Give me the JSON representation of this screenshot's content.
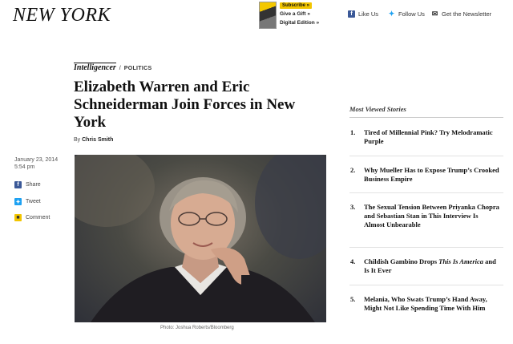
{
  "header": {
    "logo": "NEW YORK",
    "promo": {
      "subscribe": "Subscribe »",
      "gift": "Give a Gift »",
      "digital": "Digital Edition »"
    },
    "social": {
      "like": "Like Us",
      "follow": "Follow Us",
      "newsletter": "Get the Newsletter"
    }
  },
  "article": {
    "kicker_brand": "Intelligencer",
    "kicker_sep": "/",
    "section": "POLITICS",
    "headline": "Elizabeth Warren and Eric Schneiderman Join Forces in New York",
    "byline_prefix": "By",
    "author": "Chris Smith",
    "date": "January 23, 2014",
    "time": "5:54 pm",
    "share": {
      "facebook": "Share",
      "twitter": "Tweet",
      "comment": "Comment"
    },
    "photo_credit": "Photo: Joshua Roberts/Bloomberg"
  },
  "sidebar": {
    "title": "Most Viewed Stories",
    "stories": [
      {
        "num": "1.",
        "title": "Tired of Millennial Pink? Try Melodramatic Purple"
      },
      {
        "num": "2.",
        "title": "Why Mueller Has to Expose Trump’s Crooked Business Empire"
      },
      {
        "num": "3.",
        "title": "The Sexual Tension Between Priyanka Chopra and Sebastian Stan in This Interview Is Almost Unbearable"
      },
      {
        "num": "4.",
        "title_a": "Childish Gambino Drops ",
        "title_b": "This Is America",
        "title_c": " and Is It Ever"
      },
      {
        "num": "5.",
        "title": "Melania, Who Swats Trump’s Hand Away, Might Not Like Spending Time With Him"
      }
    ]
  },
  "icons": {
    "facebook": "facebook-icon",
    "twitter": "twitter-icon",
    "mail": "mail-icon",
    "comment": "comment-icon"
  },
  "colors": {
    "facebook": "#3b5998",
    "twitter": "#1da1f2",
    "subscribe": "#f2c500"
  }
}
